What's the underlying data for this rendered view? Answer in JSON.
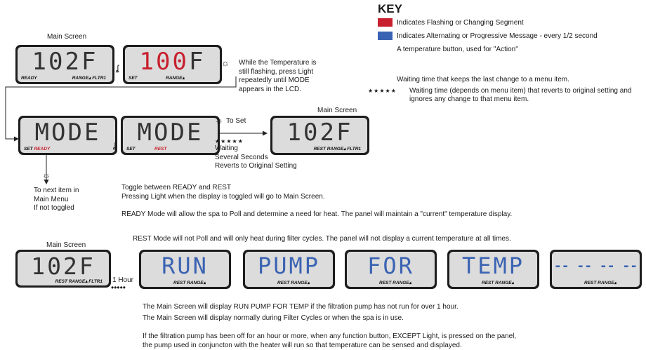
{
  "key": {
    "title": "KEY",
    "flashing": "Indicates Flashing or Changing Segment",
    "alternating": "Indicates Alternating or Progressive Message - every 1/2 second",
    "button": "A temperature button, used for \"Action\"",
    "waiting": "Waiting time that keeps the last change to a menu item.",
    "stars": "★★★★★",
    "revert_line1": "Waiting time (depends on menu item) that reverts to original setting and",
    "revert_line2": "ignores any change to that menu item.",
    "colors": {
      "flashing": "#c8202e",
      "alternating": "#3b63b3"
    }
  },
  "row1": {
    "main_title": "Main Screen",
    "lcd1": {
      "digits": "102F",
      "ready": "READY",
      "range": "RANGE▴ FLTR1"
    },
    "lcd2": {
      "digits": "100",
      "suffix": "F",
      "set": "SET",
      "range": "RANGE▴"
    },
    "note": [
      "While the Temperature is",
      "still flashing, press Light",
      "repeatedly until MODE",
      "appears in the LCD."
    ]
  },
  "row2": {
    "lcd3": {
      "digits": "MODE",
      "set": "SET",
      "ready": "READY"
    },
    "lcd4": {
      "digits": "MODE",
      "set": "SET",
      "rest": "REST"
    },
    "to_set": "To Set",
    "stars": "★★★★★",
    "waiting": [
      "Waiting",
      "Several Seconds",
      "Reverts to Original Setting"
    ],
    "main_title": "Main Screen",
    "lcd5": {
      "digits": "102F",
      "range": "REST RANGE▴ FLTR1"
    },
    "next_item": [
      "To next item in",
      "Main Menu",
      "If not toggled"
    ],
    "toggle": [
      "Toggle between READY and REST",
      "Pressing Light when the display is toggled will go to Main Screen."
    ],
    "ready_mode": "READY Mode will allow the spa to Poll and determine a need for heat. The panel will maintain a \"current\" temperature display."
  },
  "row3": {
    "rest_mode": "REST Mode will not Poll and will only heat during filter cycles. The panel will not display a current temperature at all times.",
    "main_title": "Main Screen",
    "lcd6": {
      "digits": "102F",
      "range": "REST RANGE▴ FLTR1"
    },
    "one_hour": "1 Hour",
    "screens": [
      {
        "digits": "RUN",
        "range": "REST RANGE▴"
      },
      {
        "digits": "PUMP",
        "range": "REST RANGE▴"
      },
      {
        "digits": "FOR",
        "range": "REST RANGE▴"
      },
      {
        "digits": "TEMP",
        "range": "REST RANGE▴"
      },
      {
        "digits": "-- -- -- --",
        "range": "REST RANGE▴"
      }
    ],
    "notes": [
      "The Main Screen will display RUN PUMP FOR TEMP if the filtration pump has not run for over 1 hour.",
      "The Main Screen will display normally during Filter Cycles or when the spa is in use."
    ],
    "footer": [
      "If the filtration pump has been off for an hour or more, when any function button, EXCEPT Light, is pressed on the panel,",
      "the pump used in conjuncton with the heater will run so that temperature can be sensed and displayed."
    ]
  }
}
